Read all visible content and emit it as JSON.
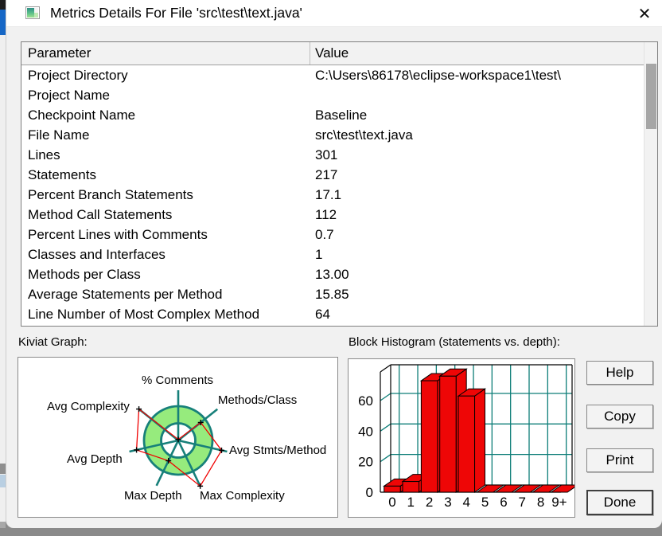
{
  "window": {
    "title": "Metrics Details For File 'src\\test\\text.java'",
    "close_glyph": "✕"
  },
  "section_labels": {
    "kiviat": "Kiviat Graph:",
    "histogram": "Block Histogram (statements vs. depth):"
  },
  "table": {
    "columns": [
      "Parameter",
      "Value"
    ],
    "rows": [
      {
        "param": "Project Directory",
        "value": "C:\\Users\\86178\\eclipse-workspace1\\test\\"
      },
      {
        "param": "Project Name",
        "value": ""
      },
      {
        "param": "Checkpoint Name",
        "value": "Baseline"
      },
      {
        "param": "File Name",
        "value": "src\\test\\text.java"
      },
      {
        "param": "Lines",
        "value": "301"
      },
      {
        "param": "Statements",
        "value": "217"
      },
      {
        "param": "Percent Branch Statements",
        "value": "17.1"
      },
      {
        "param": "Method Call Statements",
        "value": "112"
      },
      {
        "param": "Percent Lines with Comments",
        "value": "0.7"
      },
      {
        "param": "Classes and Interfaces",
        "value": "1"
      },
      {
        "param": "Methods per Class",
        "value": "13.00"
      },
      {
        "param": "Average Statements per Method",
        "value": "15.85"
      },
      {
        "param": "Line Number of Most Complex Method",
        "value": "64"
      }
    ]
  },
  "buttons": {
    "help": "Help",
    "copy": "Copy",
    "print": "Print",
    "done": "Done"
  },
  "colors": {
    "kiviat_band_fill": "#96EB7D",
    "kiviat_axis_teal": "#17807A",
    "kiviat_data_red": "#F00000",
    "marker_black": "#000000",
    "bar_fill_red": "#EE0606",
    "grid_teal": "#0E7E78"
  },
  "chart_data": [
    {
      "type": "radar",
      "title": "Kiviat Graph",
      "axes": [
        "% Comments",
        "Methods/Class",
        "Avg Stmts/Method",
        "Max Complexity",
        "Max Depth",
        "Avg Depth",
        "Avg Complexity"
      ],
      "values_vs_normal_band": [
        0.03,
        0.84,
        1.3,
        1.48,
        0.66,
        1.25,
        1.47
      ],
      "normal_band_inner": 0.5,
      "normal_band_outer": 1.0,
      "legend_position": "none"
    },
    {
      "type": "bar",
      "title": "Block Histogram (statements vs. depth)",
      "categories": [
        "0",
        "1",
        "2",
        "3",
        "4",
        "5",
        "6",
        "7",
        "8",
        "9+"
      ],
      "values": [
        4,
        7,
        73,
        76,
        63,
        0,
        0,
        0,
        0,
        0
      ],
      "xlabel": "depth",
      "ylabel": "statements",
      "yticks": [
        0,
        20,
        40,
        60
      ],
      "ylim": [
        0,
        79
      ],
      "grid": true,
      "style": "3d-red-blocks"
    }
  ]
}
